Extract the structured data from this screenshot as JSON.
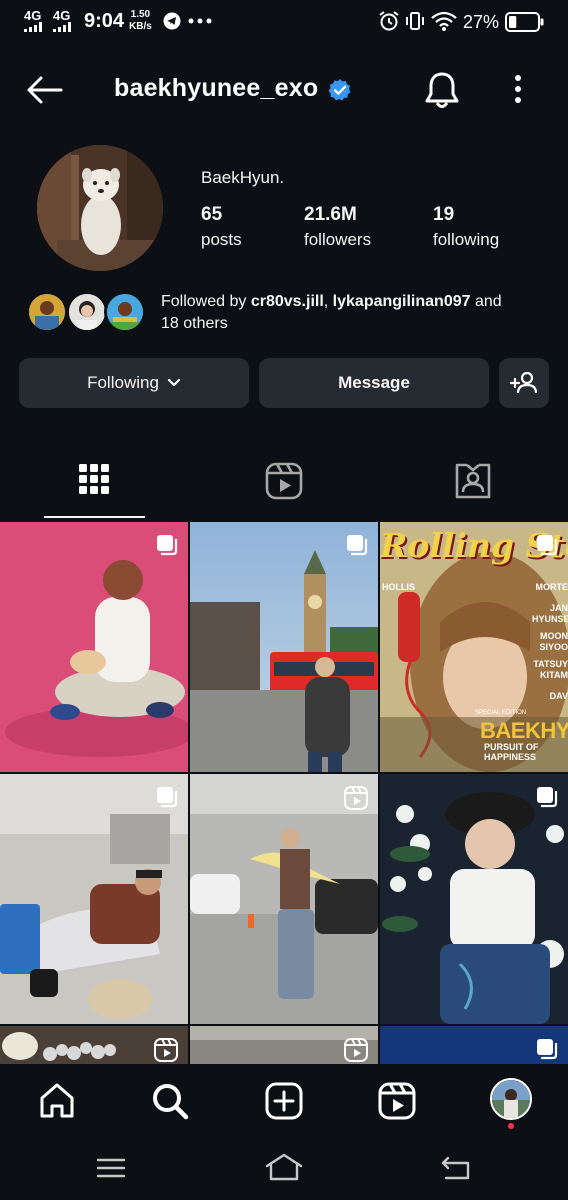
{
  "status_bar": {
    "network_1": "4G",
    "network_2": "4G",
    "time": "9:04",
    "speed_value": "1.50",
    "speed_unit": "KB/s",
    "battery_percent": "27%",
    "battery_level": 0.27
  },
  "header": {
    "username": "baekhyunee_exo",
    "verified": true,
    "accent_color": "#3897f0"
  },
  "profile": {
    "display_name": "BaekHyun.",
    "stats": [
      {
        "value": "65",
        "label": "posts"
      },
      {
        "value": "21.6M",
        "label": "followers"
      },
      {
        "value": "19",
        "label": "following"
      }
    ],
    "followed_by": {
      "prefix": "Followed by ",
      "user_1": "cr80vs.jill",
      "separator": ", ",
      "user_2": "lykapangilinan097",
      "suffix_1": " and",
      "suffix_2": "18 others"
    }
  },
  "actions": {
    "following_label": "Following",
    "message_label": "Message",
    "add_person_icon": "add-person-icon"
  },
  "tabs": [
    {
      "name": "posts",
      "icon": "grid-icon",
      "active": true
    },
    {
      "name": "reels",
      "icon": "reels-icon",
      "active": false
    },
    {
      "name": "tagged",
      "icon": "tagged-icon",
      "active": false
    }
  ],
  "posts": {
    "tile_5_overlay": [
      "Rolling Stone",
      "BAEKHYUN",
      "PURSUIT OF HAPPINESS",
      "HOLLIS",
      "MORTE",
      "JAN",
      "HYUNSEUN",
      "MOON",
      "SIYOO",
      "TATSUY",
      "KITAM",
      "DAV",
      "SPECIAL EDITION"
    ]
  },
  "bottom_nav": [
    "home-icon",
    "search-icon",
    "create-icon",
    "reels-icon",
    "profile-avatar"
  ],
  "system_nav": [
    "recents-icon",
    "home-icon",
    "back-icon"
  ]
}
